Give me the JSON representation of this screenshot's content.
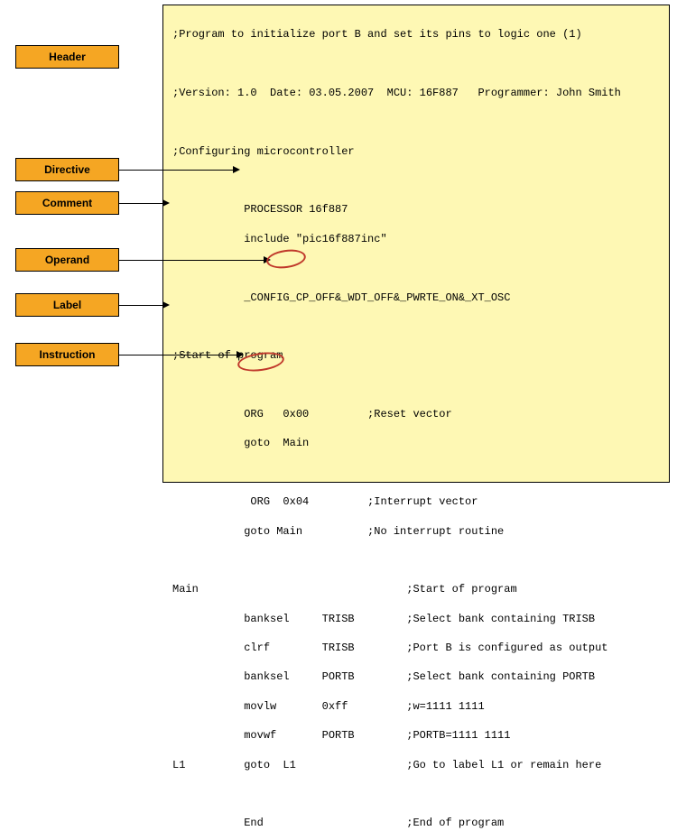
{
  "labels": {
    "header": "Header",
    "directive": "Directive",
    "comment": "Comment",
    "operand": "Operand",
    "label": "Label",
    "instruction": "Instruction"
  },
  "code": {
    "l01": ";Program to initialize port B and set its pins to logic one (1)",
    "l02": "",
    "l03": ";Version: 1.0  Date: 03.05.2007  MCU: 16F887   Programmer: John Smith",
    "l04": "",
    "l05": ";Configuring microcontroller",
    "l06": "",
    "l07": "           PROCESSOR 16f887",
    "l08": "           include \"pic16f887inc\"",
    "l09": "",
    "l10": "           _CONFIG_CP_OFF&_WDT_OFF&_PWRTE_ON&_XT_OSC",
    "l11": "",
    "l12": ";Start of program",
    "l13": "",
    "l14": "           ORG   0x00         ;Reset vector",
    "l15": "           goto  Main",
    "l16": "",
    "l17": "            ORG  0x04         ;Interrupt vector",
    "l18": "           goto Main          ;No interrupt routine",
    "l19": "",
    "l20": "Main                                ;Start of program",
    "l21": "           banksel     TRISB        ;Select bank containing TRISB",
    "l22": "           clrf        TRISB        ;Port B is configured as output",
    "l23": "           banksel     PORTB        ;Select bank containing PORTB",
    "l24": "           movlw       0xff         ;w=1111 1111",
    "l25": "           movwf       PORTB        ;PORTB=1111 1111",
    "l26": "L1         goto  L1                 ;Go to label L1 or remain here",
    "l27": "",
    "l28": "           End                      ;End of program"
  }
}
